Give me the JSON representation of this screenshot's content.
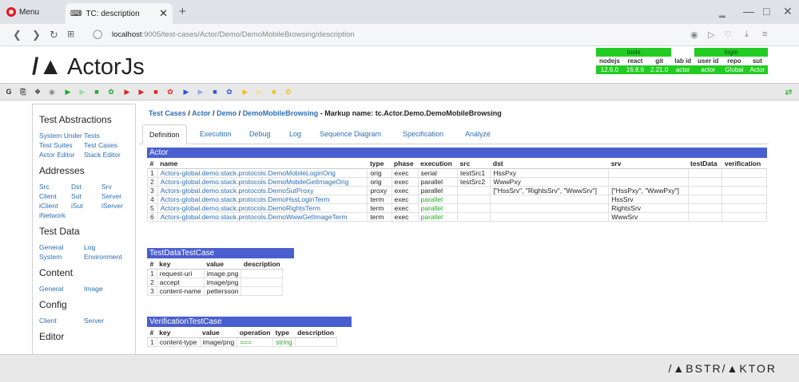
{
  "browser": {
    "menu_label": "Menu",
    "tab_title": "TC: description",
    "new_tab": "+",
    "url_host": "localhost",
    "url_path": ":9005/test-cases/Actor/Demo/DemoMobileBrowsing/description"
  },
  "app": {
    "logo_mark": "/▲",
    "logo_text": "ActorJs"
  },
  "status": {
    "groups": [
      "tools",
      "login"
    ],
    "labels": [
      "nodejs",
      "react",
      "git",
      "lab id",
      "user id",
      "repo",
      "sut"
    ],
    "values": [
      "12.6.0",
      "16.8.6",
      "2.21.0",
      "actor",
      "actor",
      "Global",
      "Actor"
    ]
  },
  "colors": {
    "brand_blue": "#4a5fcf",
    "link": "#2a6fb5",
    "status_green": "#22cc22",
    "play_green": "#22aa22",
    "stop_red": "#e02020"
  },
  "sidebar": {
    "sections": [
      "Test Abstractions",
      "Addresses",
      "Test Data",
      "Content",
      "Config",
      "Editor"
    ],
    "abstractions": [
      "System Under Tests",
      "Test Suites",
      "Test Cases",
      "Actor Editor",
      "Stack Editor"
    ],
    "addresses": [
      "Src",
      "Dst",
      "Srv",
      "Client",
      "Sut",
      "Server",
      "iClient",
      "iSut",
      "iServer",
      "iNetwork"
    ],
    "testdata": [
      "General",
      "Log",
      "System",
      "Environment"
    ],
    "content": [
      "General",
      "Image"
    ],
    "config": [
      "Client",
      "Server"
    ]
  },
  "breadcrumb": {
    "items": [
      "Test Cases",
      "Actor",
      "Demo",
      "DemoMobileBrowsing"
    ],
    "sep": "/",
    "markup": "-  Markup name: tc.Actor.Demo.DemoMobileBrowsing"
  },
  "tabs": [
    "Definition",
    "Execution",
    "Debug",
    "Log",
    "Sequence Diagram",
    "Specification",
    "Analyze"
  ],
  "actor_table": {
    "title": "Actor",
    "headers": [
      "#",
      "name",
      "type",
      "phase",
      "execution",
      "src",
      "dst",
      "srv",
      "testData",
      "verification"
    ],
    "rows": [
      [
        "1",
        "Actors-global.demo.stack.protocols.DemoMobileLoginOrig",
        "orig",
        "exec",
        "serial",
        "testSrc1",
        "HssPxy",
        "",
        "",
        ""
      ],
      [
        "2",
        "Actors-global.demo.stack.protocols.DemoMobileGetImageOrig",
        "orig",
        "exec",
        "parallel",
        "testSrc2",
        "WwwPxy",
        "",
        "",
        ""
      ],
      [
        "3",
        "Actors-global.demo.stack.protocols.DemoSutProxy",
        "proxy",
        "exec",
        "parallel",
        "",
        "[\"HssSrv\", \"RightsSrv\", \"WwwSrv\"]",
        "[\"HssPxy\", \"WwwPxy\"]",
        "",
        ""
      ],
      [
        "4",
        "Actors-global.demo.stack.protocols.DemoHssLoginTerm",
        "term",
        "exec",
        "parallel",
        "",
        "",
        "HssSrv",
        "",
        ""
      ],
      [
        "5",
        "Actors-global.demo.stack.protocols.DemoRightsTerm",
        "term",
        "exec",
        "parallel",
        "",
        "",
        "RightsSrv",
        "",
        ""
      ],
      [
        "6",
        "Actors-global.demo.stack.protocols.DemoWwwGetImageTerm",
        "term",
        "exec",
        "parallel",
        "",
        "",
        "WwwSrv",
        "",
        ""
      ]
    ]
  },
  "testdata_table": {
    "title": "TestDataTestCase",
    "headers": [
      "#",
      "key",
      "value",
      "description"
    ],
    "rows": [
      [
        "1",
        "request-uri",
        "image.png",
        ""
      ],
      [
        "2",
        "accept",
        "image/png",
        ""
      ],
      [
        "3",
        "content-name",
        "pettersson",
        ""
      ]
    ]
  },
  "verification_table": {
    "title": "VerificationTestCase",
    "headers": [
      "#",
      "key",
      "value",
      "operation",
      "type",
      "description"
    ],
    "rows": [
      [
        "1",
        "content-type",
        "image/png",
        "===",
        "string",
        ""
      ]
    ]
  },
  "footer": {
    "brand": "/▲BSTR/▲KTOR"
  }
}
